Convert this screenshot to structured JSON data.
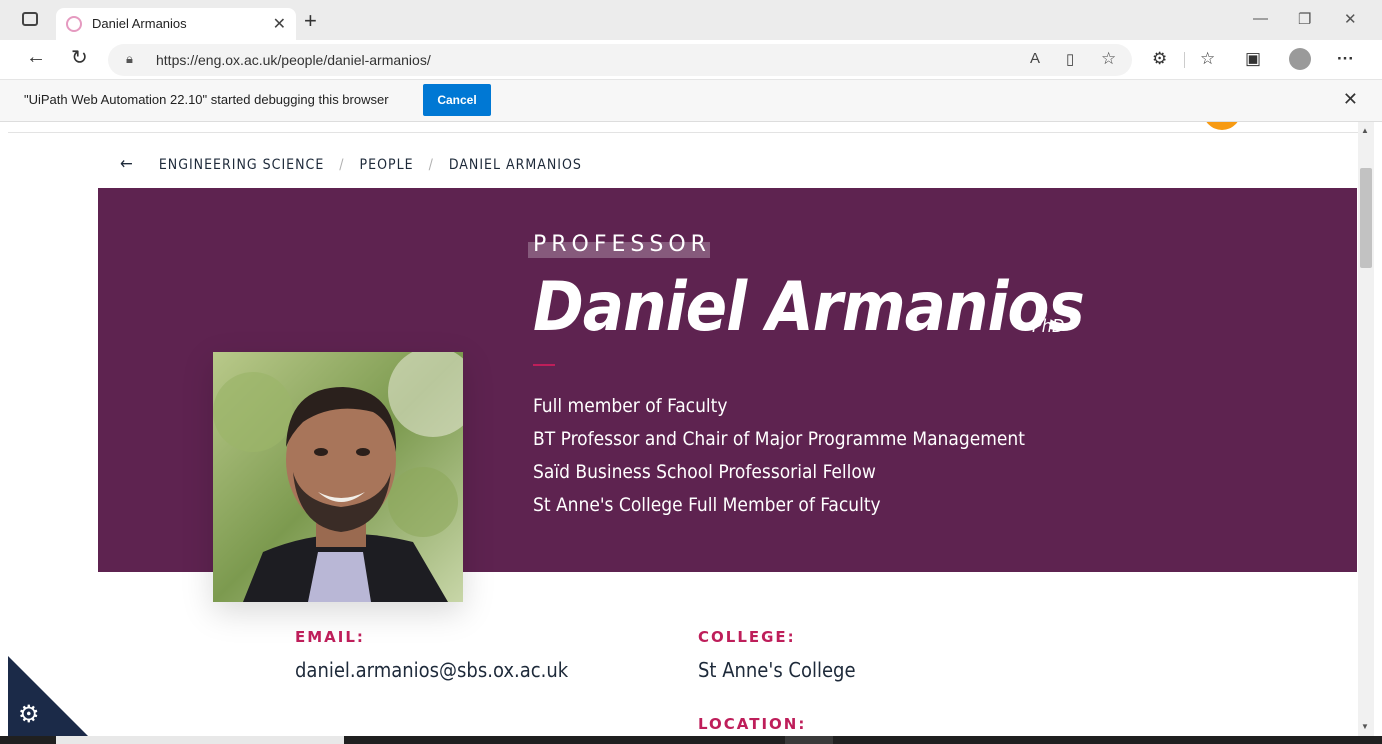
{
  "browser": {
    "tab_title": "Daniel Armanios",
    "url": "https://eng.ox.ac.uk/people/daniel-armanios/",
    "infobar_message": "\"UiPath Web Automation 22.10\" started debugging this browser",
    "infobar_button": "Cancel"
  },
  "breadcrumb": {
    "items": [
      "ENGINEERING SCIENCE",
      "PEOPLE",
      "DANIEL ARMANIOS"
    ],
    "separator": "/"
  },
  "hero": {
    "eyebrow": "PROFESSOR",
    "name": "Daniel Armanios",
    "suffix": "PhD",
    "roles": [
      "Full member of Faculty",
      "BT Professor and Chair of Major Programme Management",
      "Saïd Business School Professorial Fellow",
      "St Anne's College Full Member of Faculty"
    ],
    "background_color": "#5e2350"
  },
  "contact": {
    "email_label": "EMAIL:",
    "email_value": "daniel.armanios@sbs.ox.ac.uk",
    "college_label": "COLLEGE:",
    "college_value": "St Anne's College",
    "location_label": "LOCATION:"
  },
  "colors": {
    "accent": "#be1e5a",
    "orange": "#f79a12",
    "text_dark": "#1e2a3a",
    "cookie_bg": "#1b2a48",
    "button_blue": "#0078d4"
  }
}
